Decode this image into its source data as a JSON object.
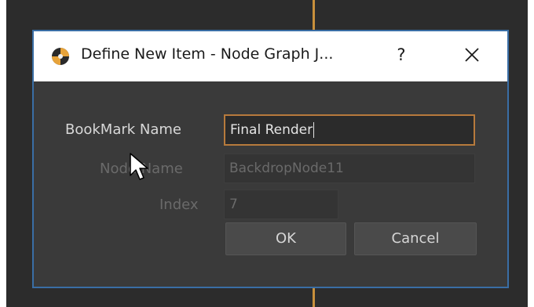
{
  "dialog": {
    "title": "Define New Item - Node Graph J...",
    "help_label": "?",
    "close_icon": "close-icon",
    "app_icon": "app-logo-icon"
  },
  "form": {
    "bookmark_name": {
      "label": "BookMark Name",
      "value": "Final Render"
    },
    "node_name": {
      "label": "Node Name",
      "value": "BackdropNode11"
    },
    "index": {
      "label": "Index",
      "value": "7"
    }
  },
  "buttons": {
    "ok_label": "OK",
    "cancel_label": "Cancel"
  },
  "colors": {
    "focus_border": "#b77a3c",
    "dialog_border": "#3a6ea5",
    "background": "#3a3a3a"
  }
}
